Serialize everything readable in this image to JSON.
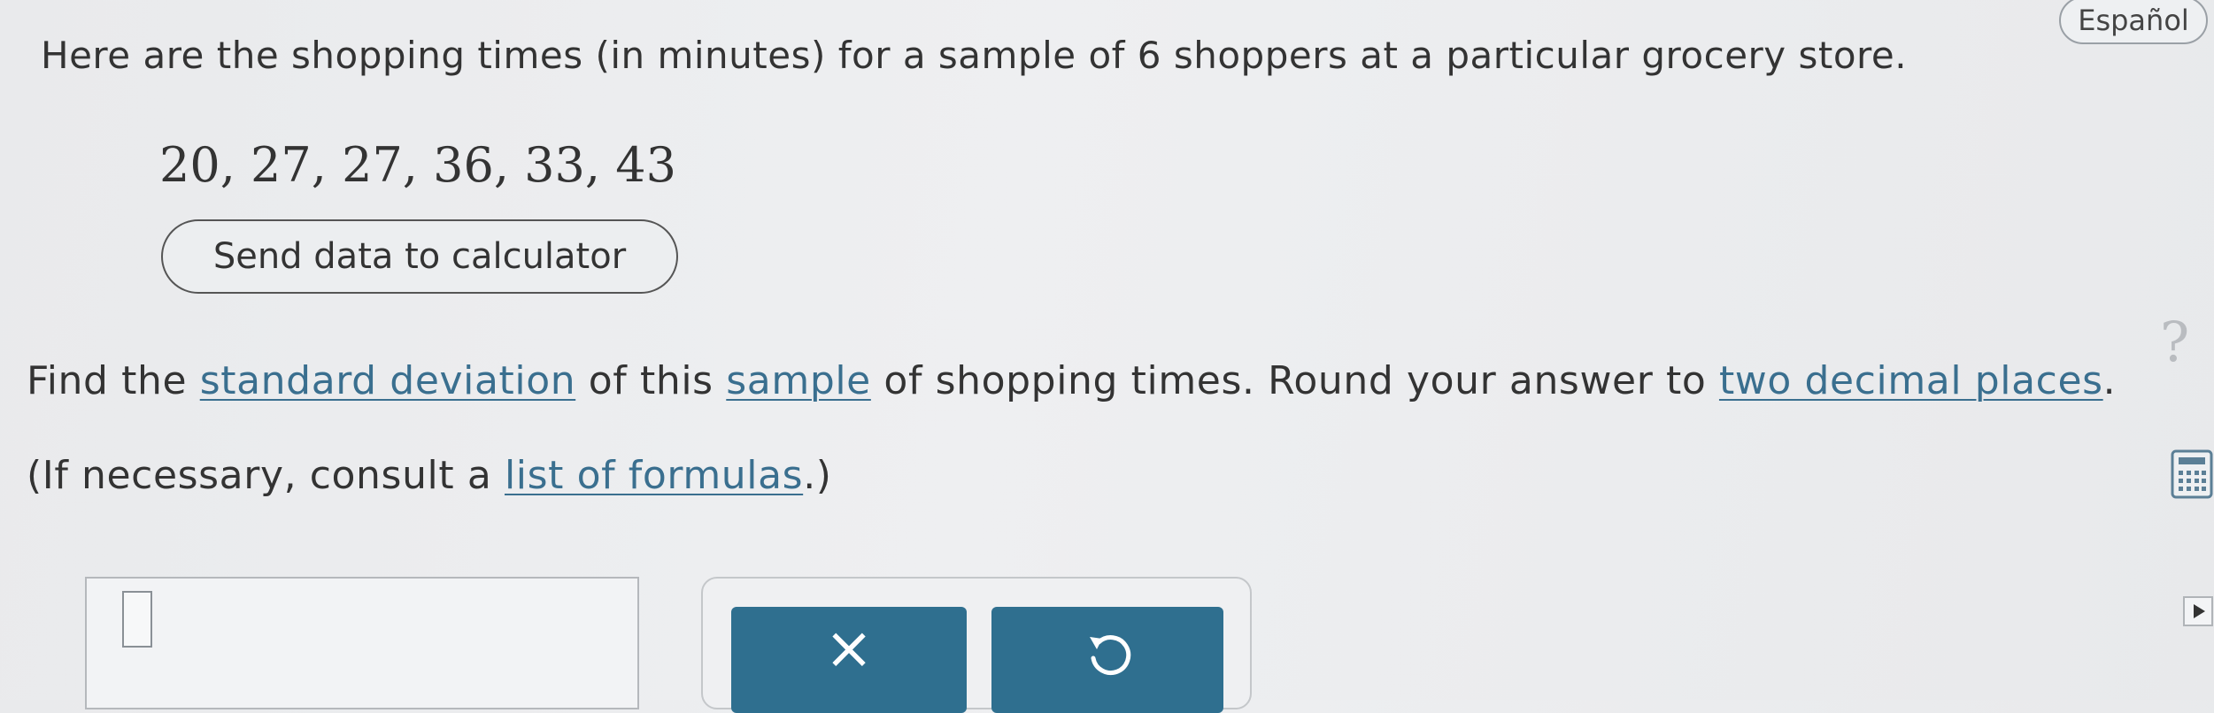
{
  "header": {
    "language_button": "Español"
  },
  "problem": {
    "intro": "Here are the shopping times (in minutes) for a sample of 6 shoppers at a particular grocery store.",
    "data_values": "20, 27, 27, 36, 33, 43",
    "send_button": "Send data to calculator",
    "question": {
      "part1": "Find the ",
      "link_std": "standard deviation",
      "part2": " of this ",
      "link_sample": "sample",
      "part3": " of shopping times. Round your answer to ",
      "link_decimal": "two decimal places",
      "part4": "."
    },
    "formulas": {
      "part1": "(If necessary, consult a ",
      "link": "list of formulas",
      "part2": ".)"
    }
  },
  "answer": {
    "value": ""
  },
  "tools": {
    "clear_symbol": "×"
  },
  "icons": {
    "help": "question-mark-icon",
    "calculator": "calculator-icon",
    "undo": "undo-icon",
    "play": "play-icon"
  },
  "colors": {
    "accent": "#2f6f8f",
    "link": "#3a6f8f"
  }
}
